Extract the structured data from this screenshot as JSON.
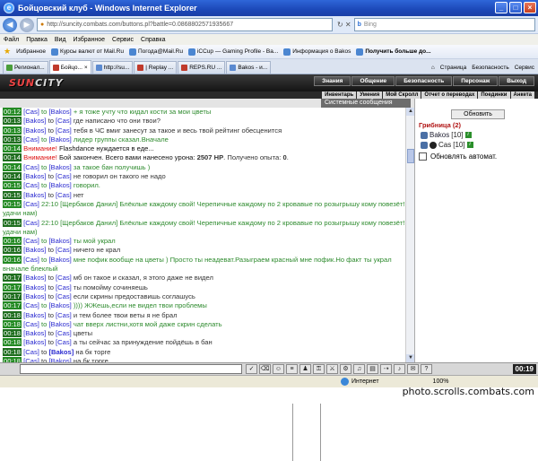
{
  "window": {
    "title": "Бойцовский клуб - Windows Internet Explorer",
    "btn_min": "_",
    "btn_max": "□",
    "btn_close": "×"
  },
  "address": {
    "url": "http://suncity.combats.com/buttons.pl?battle=0.0868802571935667",
    "search_placeholder": "Bing"
  },
  "menu": [
    "Файл",
    "Правка",
    "Вид",
    "Избранное",
    "Сервис",
    "Справка"
  ],
  "favorites": {
    "label": "Избранное",
    "items": [
      "Курсы валют от Mail.Ru",
      "Погода@Mail.Ru",
      "iCCup — Gaming Profile - Ba...",
      "Информация о Bakos",
      "Получить больше до..."
    ]
  },
  "tabs": [
    "Регионал...",
    "Бойцо...",
    "http://su...",
    "| Replay ...",
    "REPS.RU ...",
    "Bakos - и..."
  ],
  "tab_tools": [
    "Страница",
    "Безопасность",
    "Сервис"
  ],
  "game": {
    "logo_a": "SUN",
    "logo_b": "CITY",
    "nav": [
      "Знания",
      "Общение",
      "Безопасность",
      "Персонаж",
      "Выход"
    ],
    "subnav": [
      "Инвентарь",
      "Умения",
      "Мой Скролл",
      "Отчет о переводах",
      "Поединки",
      "Анкета"
    ],
    "tab_chat": "Чат",
    "tab_system": "Системные сообщения"
  },
  "chat_lines": [
    {
      "t": "00:12",
      "a": "[Cas]",
      "to": "to",
      "b": "[Bakos]",
      "msg": " + я тоже учту что кидал кости за мои цветы",
      "green": true
    },
    {
      "t": "00:13",
      "a": "[Bakos]",
      "to": "to",
      "b": "[Cas]",
      "msg": " где написано что они твои?"
    },
    {
      "t": "00:13",
      "a": "[Bakos]",
      "to": "to",
      "b": "[Cas]",
      "msg": " тебя в ЧС вмиг занесут за такое и весь твой рейтинг обесценится"
    },
    {
      "t": "00:13",
      "a": "[Cas]",
      "to": "to",
      "b": "[Bakos]",
      "msg": " лидер группы сказал.Вначале",
      "green": true
    },
    {
      "t": "00:14",
      "warn": "Внимание!",
      "msg": " Flashdance нуждается в еде..."
    },
    {
      "t": "00:14",
      "warn": "Внимание!",
      "msg": " Бой закончен. Всего вами нанесено урона: ",
      "bold": "2507 HP",
      "msg2": ". Получено опыта: ",
      "bold2": "0",
      "msg3": "."
    },
    {
      "t": "00:14",
      "a": "[Cas]",
      "to": "to",
      "b": "[Bakos]",
      "msg": " за такое бан получишь )",
      "green": true
    },
    {
      "t": "00:14",
      "a": "[Bakos]",
      "to": "to",
      "b": "[Cas]",
      "msg": " не говорил он такого не надо"
    },
    {
      "t": "00:15",
      "a": "[Cas]",
      "to": "to",
      "b": "[Bakos]",
      "msg": " говорил.",
      "green": true
    },
    {
      "t": "00:15",
      "a": "[Bakos]",
      "to": "to",
      "b": "[Cas]",
      "msg": " нет"
    },
    {
      "t": "00:15",
      "a": "[Cas]",
      "msg": " 22:10 [Щербаков Данил] Блёклые каждому свой! Черепичные каждому по 2 кровавые по розыгрышу кому повезёт! удачи нам)",
      "green": true,
      "noTo": true
    },
    {
      "t": "00:15",
      "a": "[Cas]",
      "msg": " 22:10 [Щербаков Данил] Блёклые каждому свой! Черепичные каждому по 2 кровавые по розыгрышу кому повезёт! удачи нам)",
      "green": true,
      "noTo": true
    },
    {
      "t": "00:16",
      "a": "[Cas]",
      "to": "to",
      "b": "[Bakos]",
      "msg": " ты мой украл",
      "green": true
    },
    {
      "t": "00:16",
      "a": "[Bakos]",
      "to": "to",
      "b": "[Cas]",
      "msg": " ничего не крал"
    },
    {
      "t": "00:16",
      "a": "[Cas]",
      "to": "to",
      "b": "[Bakos]",
      "msg": " мне пофик вообще на цветы ) Просто ты неадеват.Разыграем красный мне пофик.Но факт ты украл вначале блеклый",
      "green": true
    },
    {
      "t": "00:17",
      "a": "[Bakos]",
      "to": "to",
      "b": "[Cas]",
      "msg": " мб он такое и сказал, я этого даже не видел"
    },
    {
      "t": "00:17",
      "a": "[Bakos]",
      "to": "to",
      "b": "[Cas]",
      "msg": " ты помойму сочиняешь"
    },
    {
      "t": "00:17",
      "a": "[Bakos]",
      "to": "to",
      "b": "[Cas]",
      "msg": " если скрины предоставишь соглашусь"
    },
    {
      "t": "00:17",
      "a": "[Cas]",
      "to": "to",
      "b": "[Bakos]",
      "msg": " )))) ЖЖешь,если не видел твои проблемы",
      "green": true
    },
    {
      "t": "00:18",
      "a": "[Bakos]",
      "to": "to",
      "b": "[Cas]",
      "msg": " и тем более твои веты я не брал"
    },
    {
      "t": "00:18",
      "a": "[Cas]",
      "to": "to",
      "b": "[Bakos]",
      "msg": " чат вверх листни,хотя мой даже скрин сделать",
      "green": true
    },
    {
      "t": "00:18",
      "a": "[Bakos]",
      "to": "to",
      "b": "[Cas]",
      "msg": " цветы"
    },
    {
      "t": "00:18",
      "a": "[Bakos]",
      "to": "to",
      "b": "[Cas]",
      "msg": " а ты сейчас за принуждение пойдёшь в бан"
    },
    {
      "t": "00:18",
      "a": "[Cas]",
      "to": "to",
      "b": "[Bakos]",
      "msg": " на бк торге",
      "boldB": true
    },
    {
      "t": "00:18",
      "a": "[Cas]",
      "to": "to",
      "b": "[Bakos]",
      "msg": " на бк торге"
    },
    {
      "t": "00:18",
      "a": "[Cas]",
      "to": "to",
      "b": "[Bakos]",
      "msg": " брал и сам сказал легче за них играть",
      "green": true
    },
    {
      "t": "00:19",
      "a": "[Bakos]",
      "to": "to",
      "b": "[Cas]",
      "msg": " ибо если он так говорит то красные на розыгрышь а ты меня под принуждением бана велел отдать тебе"
    },
    {
      "t": "00:19",
      "a": "[Cas]",
      "to": "to",
      "b": "[Bakos]",
      "msg": " т.е кидать кости )Не смеши",
      "green": true
    }
  ],
  "panel": {
    "refresh_label": "Обновить",
    "group_title": "Грибница (2)",
    "members": [
      {
        "name": "Bakos",
        "level": "[10]"
      },
      {
        "name": "Cas",
        "level": "[10]"
      }
    ],
    "auto_label": "Обновлять автомат."
  },
  "toolbar": {
    "clock": "00:19"
  },
  "statusbar": {
    "zone": "Интернет",
    "zoom": "100%"
  },
  "watermark": "photo.scrolls.combats.com"
}
